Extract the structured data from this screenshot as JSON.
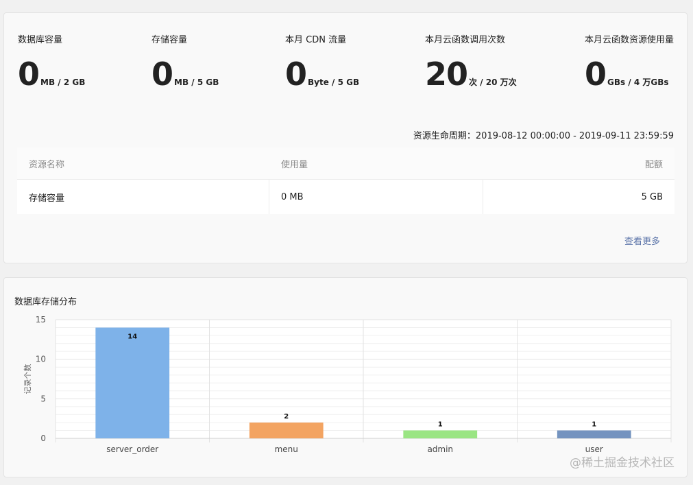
{
  "stats": [
    {
      "label": "数据库容量",
      "value": "0",
      "unit": "MB / 2 GB"
    },
    {
      "label": "存储容量",
      "value": "0",
      "unit": "MB / 5 GB"
    },
    {
      "label": "本月 CDN 流量",
      "value": "0",
      "unit": "Byte / 5 GB"
    },
    {
      "label": "本月云函数调用次数",
      "value": "20",
      "unit": "次 / 20 万次"
    },
    {
      "label": "本月云函数资源使用量",
      "value": "0",
      "unit": "GBs / 4 万GBs"
    }
  ],
  "lifecycle": "资源生命周期：2019-08-12 00:00:00 - 2019-09-11 23:59:59",
  "table": {
    "headers": [
      "资源名称",
      "使用量",
      "配额"
    ],
    "rows": [
      [
        "存储容量",
        "0 MB",
        "5 GB"
      ]
    ]
  },
  "more_link": "查看更多",
  "chart_title": "数据库存储分布",
  "chart_data": {
    "type": "bar",
    "title": "",
    "xlabel": "",
    "ylabel": "记录个数",
    "categories": [
      "server_order",
      "menu",
      "admin",
      "user"
    ],
    "values": [
      14,
      2,
      1,
      1
    ],
    "data_labels": [
      "14",
      "2",
      "1",
      "1"
    ],
    "yticks": [
      "0",
      "5",
      "10",
      "15"
    ],
    "ylim": [
      0,
      15
    ],
    "colors": [
      "#7eb2e9",
      "#f3a462",
      "#9ae583",
      "#7493bf"
    ],
    "grid": true
  },
  "watermark": "@稀土掘金技术社区"
}
